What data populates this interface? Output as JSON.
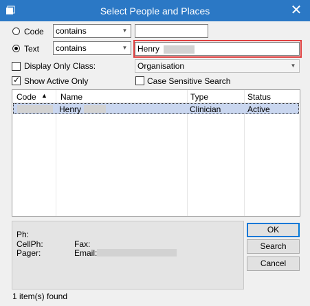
{
  "window": {
    "title": "Select People and Places",
    "close_icon": "close-icon"
  },
  "search": {
    "code_label": "Code",
    "code_operator": "contains",
    "code_value": "",
    "text_label": "Text",
    "text_operator": "contains",
    "text_value": "Henry",
    "selected_mode": "text",
    "display_only_class_label": "Display Only Class:",
    "display_only_class_value": "Organisation",
    "display_only_class_checked": false,
    "show_active_only_label": "Show Active Only",
    "show_active_only_checked": true,
    "case_sensitive_label": "Case Sensitive Search",
    "case_sensitive_checked": false
  },
  "results": {
    "columns": [
      "Code",
      "Name",
      "Type",
      "Status"
    ],
    "sort_column": "Code",
    "rows": [
      {
        "code": "",
        "name": "Henry",
        "type": "Clinician",
        "status": "Active"
      }
    ]
  },
  "details": {
    "ph_label": "Ph:",
    "cellph_label": "CellPh:",
    "pager_label": "Pager:",
    "fax_label": "Fax:",
    "email_label": "Email:"
  },
  "buttons": {
    "ok": "OK",
    "search": "Search",
    "cancel": "Cancel"
  },
  "status": {
    "found": "1 item(s) found"
  },
  "colors": {
    "titlebar": "#2b78c5",
    "selection": "#c9d6ef",
    "highlight_box": "#e04040"
  }
}
